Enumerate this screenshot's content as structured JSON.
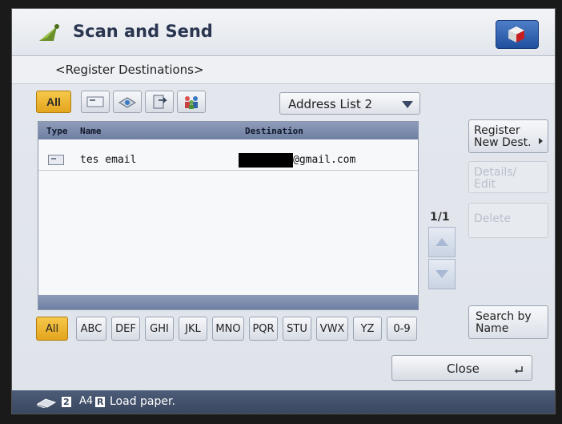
{
  "window": {
    "title": "Scan and Send",
    "subtitle": "<Register Destinations>"
  },
  "type_filter": {
    "all_label": "All",
    "buttons": [
      "card-icon",
      "network-icon",
      "fax-folder-icon",
      "group-icon"
    ]
  },
  "address_list": {
    "selected": "Address List 2"
  },
  "table": {
    "columns": [
      "Type",
      "Name",
      "Destination"
    ],
    "rows": [
      {
        "type_icon": "email-card-icon",
        "name": "tes email",
        "destination": "@gmail.com"
      }
    ]
  },
  "paging": {
    "indicator": "1/1"
  },
  "side_buttons": {
    "register": "Register\nNew Dest.",
    "details": "Details/\nEdit",
    "delete": "Delete",
    "search": "Search by\nName"
  },
  "alpha_tabs": [
    "All",
    "ABC",
    "DEF",
    "GHI",
    "JKL",
    "MNO",
    "PQR",
    "STU",
    "VWX",
    "YZ",
    "0-9"
  ],
  "close_label": "Close",
  "status": {
    "count": "2",
    "size": "A4",
    "size_badge": "R",
    "message": "Load paper."
  },
  "colors": {
    "active_tab": "#f0b83a",
    "list_header": "#7f8db0",
    "status_bar": "#425069"
  }
}
